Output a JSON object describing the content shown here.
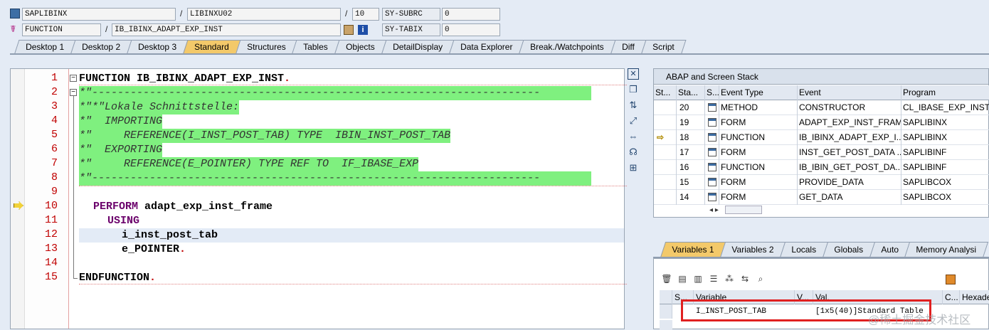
{
  "header": {
    "program": "SAPLIBINX",
    "include": "LIBINXU02",
    "line": "10",
    "subrc_label": "SY-SUBRC",
    "subrc_value": "0",
    "type": "FUNCTION",
    "name": "IB_IBINX_ADAPT_EXP_INST",
    "tabix_label": "SY-TABIX",
    "tabix_value": "0",
    "slash": "/"
  },
  "tabs": [
    "Desktop 1",
    "Desktop 2",
    "Desktop 3",
    "Standard",
    "Structures",
    "Tables",
    "Objects",
    "DetailDisplay",
    "Data Explorer",
    "Break./Watchpoints",
    "Diff",
    "Script"
  ],
  "active_tab": "Standard",
  "code": {
    "line_numbers": [
      "1",
      "2",
      "3",
      "4",
      "5",
      "6",
      "7",
      "8",
      "9",
      "10",
      "11",
      "12",
      "13",
      "14",
      "15"
    ],
    "l1_kw": "FUNCTION IB_IBINX_ADAPT_EXP_INST",
    "l1_dot": ".",
    "l2": "*\"----------------------------------------------------------------------",
    "l3": "*\"*\"Lokale Schnittstelle:",
    "l4": "*\"  IMPORTING",
    "l5": "*\"     REFERENCE(I_INST_POST_TAB) TYPE  IBIN_INST_POST_TAB",
    "l6": "*\"  EXPORTING",
    "l7": "*\"     REFERENCE(E_POINTER) TYPE REF TO  IF_IBASE_EXP",
    "l8": "*\"----------------------------------------------------------------------",
    "l10_kw": "PERFORM",
    "l10_rest": " adapt_exp_inst_frame",
    "l11": "USING",
    "l12": "i_inst_post_tab",
    "l13": "e_POINTER",
    "l13_dot": ".",
    "l15": "ENDFUNCTION",
    "l15_dot": "."
  },
  "stack": {
    "title": "ABAP and Screen Stack",
    "columns": [
      "St...",
      "Sta...",
      "S...",
      "Event Type",
      "Event",
      "Program"
    ],
    "rows": [
      {
        "level": "20",
        "etype": "METHOD",
        "event": "CONSTRUCTOR",
        "program": "CL_IBASE_EXP_INST=",
        "current": false
      },
      {
        "level": "19",
        "etype": "FORM",
        "event": "ADAPT_EXP_INST_FRAM...",
        "program": "SAPLIBINX",
        "current": false
      },
      {
        "level": "18",
        "etype": "FUNCTION",
        "event": "IB_IBINX_ADAPT_EXP_I...",
        "program": "SAPLIBINX",
        "current": true
      },
      {
        "level": "17",
        "etype": "FORM",
        "event": "INST_GET_POST_DATA ...",
        "program": "SAPLIBINF",
        "current": false
      },
      {
        "level": "16",
        "etype": "FUNCTION",
        "event": "IB_IBIN_GET_POST_DA...",
        "program": "SAPLIBINF",
        "current": false
      },
      {
        "level": "15",
        "etype": "FORM",
        "event": "PROVIDE_DATA",
        "program": "SAPLIBCOX",
        "current": false
      },
      {
        "level": "14",
        "etype": "FORM",
        "event": "GET_DATA",
        "program": "SAPLIBCOX",
        "current": false
      }
    ]
  },
  "var_tabs": [
    "Variables 1",
    "Variables 2",
    "Locals",
    "Globals",
    "Auto",
    "Memory Analysi"
  ],
  "var_active": "Variables 1",
  "vars": {
    "columns": [
      "S...",
      "Variable",
      "V...",
      "Val.",
      "C...",
      "Hexade"
    ],
    "row": {
      "variable": "I_INST_POST_TAB",
      "value": "[1x5(40)]Standard Table"
    }
  },
  "watermark": "@稀土掘金技术社区"
}
